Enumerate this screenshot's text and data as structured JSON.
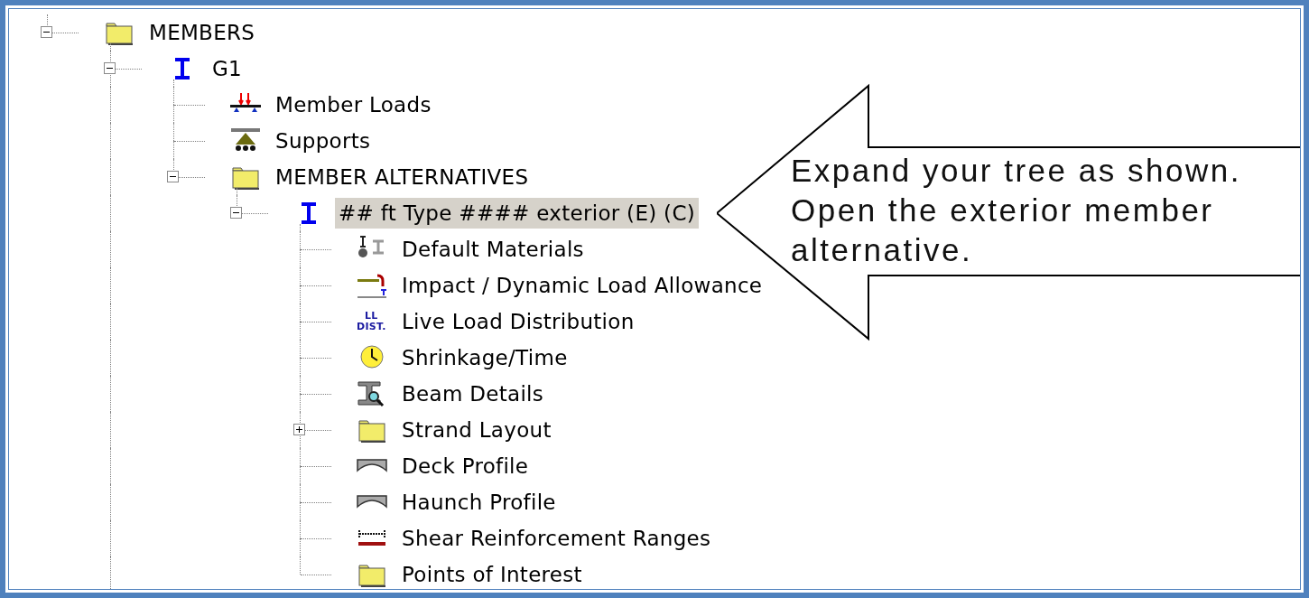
{
  "tree": [
    {
      "label": "MEMBERS",
      "kind": "folder",
      "expanded": true,
      "selected": false,
      "children": [
        {
          "label": "G1",
          "kind": "ibeam",
          "expanded": true,
          "selected": false,
          "more_siblings_below": true,
          "children": [
            {
              "label": "Member Loads",
              "kind": "loads",
              "selected": false
            },
            {
              "label": "Supports",
              "kind": "supports",
              "selected": false
            },
            {
              "label": "MEMBER ALTERNATIVES",
              "kind": "folder",
              "expanded": true,
              "selected": false,
              "children": [
                {
                  "label": "## ft Type #### exterior (E) (C)",
                  "kind": "ibeam",
                  "expanded": true,
                  "selected": true,
                  "children": [
                    {
                      "label": "Default Materials",
                      "kind": "materials",
                      "selected": false
                    },
                    {
                      "label": "Impact / Dynamic Load Allowance",
                      "kind": "impact",
                      "selected": false
                    },
                    {
                      "label": "Live Load Distribution",
                      "kind": "text",
                      "icon_lines": [
                        "LL",
                        "DIST."
                      ],
                      "selected": false
                    },
                    {
                      "label": "Shrinkage/Time",
                      "kind": "clock",
                      "selected": false
                    },
                    {
                      "label": "Beam Details",
                      "kind": "beamdetail",
                      "selected": false
                    },
                    {
                      "label": "Strand Layout",
                      "kind": "folder",
                      "expanded": false,
                      "selected": false
                    },
                    {
                      "label": "Deck Profile",
                      "kind": "profile",
                      "selected": false
                    },
                    {
                      "label": "Haunch Profile",
                      "kind": "profile",
                      "selected": false
                    },
                    {
                      "label": "Shear Reinforcement Ranges",
                      "kind": "shear",
                      "selected": false
                    },
                    {
                      "label": "Points of Interest",
                      "kind": "folder",
                      "selected": false
                    }
                  ]
                }
              ]
            }
          ]
        }
      ]
    }
  ],
  "callout": {
    "text": "Expand your tree as shown. Open the exterior member alternative."
  }
}
